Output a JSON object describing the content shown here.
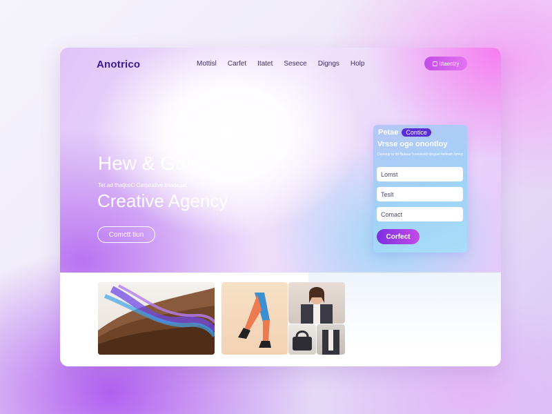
{
  "header": {
    "logo": "Anotrico",
    "nav": [
      "Mottisl",
      "Carfet",
      "Itatet",
      "Sesece",
      "Digngs",
      "Holp"
    ],
    "cta": "Ittaentry"
  },
  "hero": {
    "title": "Hew & Gdt",
    "subtitle": "Tet ad thatjcoC Cerpeative bilaqepat",
    "agency": "Creative Agency",
    "button": "Comctt tiun"
  },
  "form": {
    "head": "Petae",
    "pill": "Contice",
    "title": "Vrsse oge onontloy",
    "note": "Dasrsrgi tu dti fltulaus Tustusoslli dsrguaf ltstfeam ltmtvy",
    "fields": [
      {
        "placeholder": "Lomst"
      },
      {
        "placeholder": "Teslt"
      },
      {
        "placeholder": "Comact"
      }
    ],
    "submit": "Corfect"
  },
  "colors": {
    "brand": "#3b1a8f",
    "accent": "#c24de8",
    "form_bg": "#a8ddf8",
    "submit": "#7b2fe0"
  }
}
